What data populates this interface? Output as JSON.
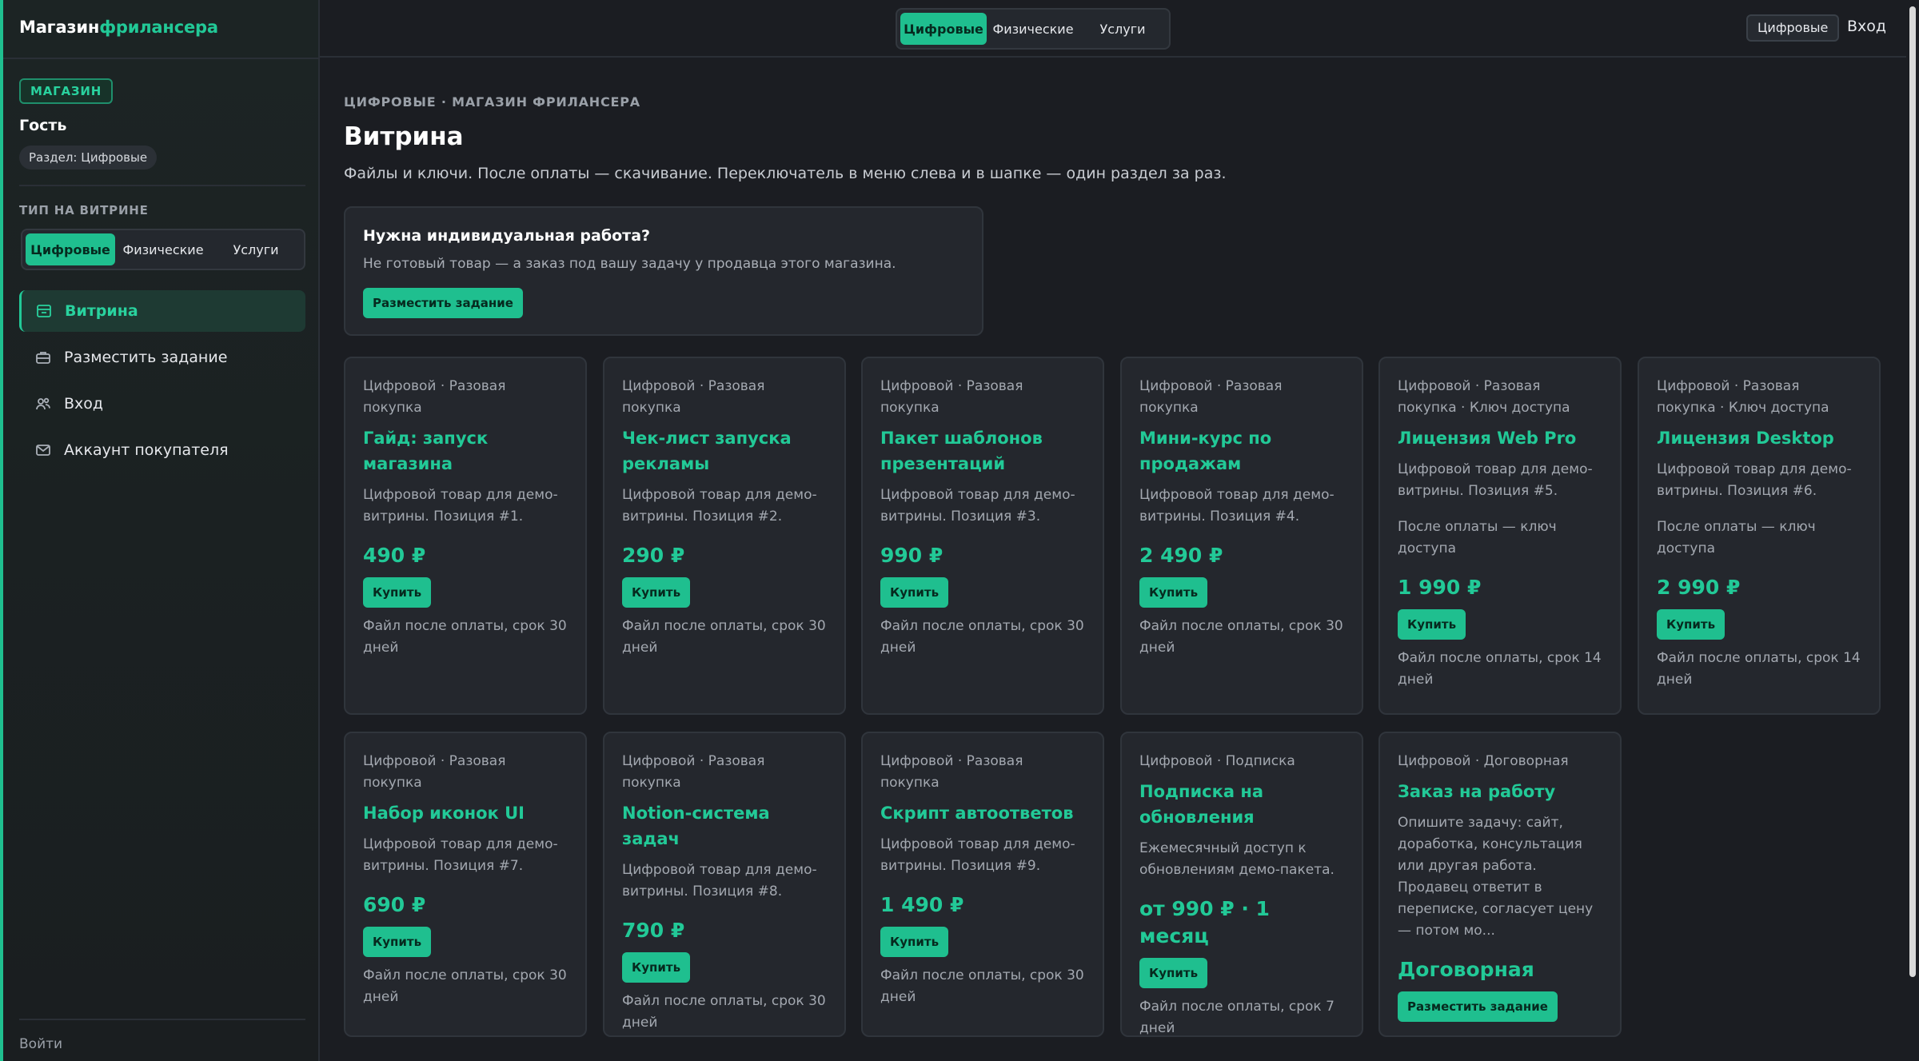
{
  "app": {
    "logo_part1": "Магазин",
    "logo_part2": "фрилансера"
  },
  "header": {
    "tabs": [
      "Цифровые",
      "Физические",
      "Услуги"
    ],
    "active_tab": 0,
    "chip": "Цифровые",
    "login": "Вход"
  },
  "sidebar": {
    "badge": "МАГАЗИН",
    "user": "Гость",
    "section_chip": "Раздел: Цифровые",
    "type_label": "ТИП НА ВИТРИНЕ",
    "type_options": [
      "Цифровые",
      "Физические",
      "Услуги"
    ],
    "nav": [
      {
        "label": "Витрина",
        "icon": "storefront-icon",
        "active": true
      },
      {
        "label": "Разместить задание",
        "icon": "briefcase-icon",
        "active": false
      },
      {
        "label": "Вход",
        "icon": "users-icon",
        "active": false
      },
      {
        "label": "Аккаунт покупателя",
        "icon": "mail-icon",
        "active": false
      }
    ],
    "logout": "Войти"
  },
  "main": {
    "breadcrumb": "ЦИФРОВЫЕ · МАГАЗИН ФРИЛАНСЕРА",
    "title": "Витрина",
    "description": "Файлы и ключи. После оплаты — скачивание. Переключатель в меню слева и в шапке — один раздел за раз.",
    "promo": {
      "title": "Нужна индивидуальная работа?",
      "text": "Не готовый товар — а заказ под вашу задачу у продавца этого магазина.",
      "button": "Разместить задание"
    },
    "products": [
      {
        "meta": "Цифровой · Разовая покупка",
        "name": "Гайд: запуск магазина",
        "desc": "Цифровой товар для демо-витрины. Позиция #1.",
        "extra": "",
        "price": "490 ₽",
        "button": "Купить",
        "note": "Файл после оплаты, срок 30 дней"
      },
      {
        "meta": "Цифровой · Разовая покупка",
        "name": "Чек-лист запуска рекламы",
        "desc": "Цифровой товар для демо-витрины. Позиция #2.",
        "extra": "",
        "price": "290 ₽",
        "button": "Купить",
        "note": "Файл после оплаты, срок 30 дней"
      },
      {
        "meta": "Цифровой · Разовая покупка",
        "name": "Пакет шаблонов презентаций",
        "desc": "Цифровой товар для демо-витрины. Позиция #3.",
        "extra": "",
        "price": "990 ₽",
        "button": "Купить",
        "note": "Файл после оплаты, срок 30 дней"
      },
      {
        "meta": "Цифровой · Разовая покупка",
        "name": "Мини-курс по продажам",
        "desc": "Цифровой товар для демо-витрины. Позиция #4.",
        "extra": "",
        "price": "2 490 ₽",
        "button": "Купить",
        "note": "Файл после оплаты, срок 30 дней"
      },
      {
        "meta": "Цифровой · Разовая покупка · Ключ доступа",
        "name": "Лицензия Web Pro",
        "desc": "Цифровой товар для демо-витрины. Позиция #5.",
        "extra": "После оплаты — ключ доступа",
        "price": "1 990 ₽",
        "button": "Купить",
        "note": "Файл после оплаты, срок 14 дней"
      },
      {
        "meta": "Цифровой · Разовая покупка · Ключ доступа",
        "name": "Лицензия Desktop",
        "desc": "Цифровой товар для демо-витрины. Позиция #6.",
        "extra": "После оплаты — ключ доступа",
        "price": "2 990 ₽",
        "button": "Купить",
        "note": "Файл после оплаты, срок 14 дней"
      },
      {
        "meta": "Цифровой · Разовая покупка",
        "name": "Набор иконок UI",
        "desc": "Цифровой товар для демо-витрины. Позиция #7.",
        "extra": "",
        "price": "690 ₽",
        "button": "Купить",
        "note": "Файл после оплаты, срок 30 дней"
      },
      {
        "meta": "Цифровой · Разовая покупка",
        "name": "Notion-система задач",
        "desc": "Цифровой товар для демо-витрины. Позиция #8.",
        "extra": "",
        "price": "790 ₽",
        "button": "Купить",
        "note": "Файл после оплаты, срок 30 дней"
      },
      {
        "meta": "Цифровой · Разовая покупка",
        "name": "Скрипт автоответов",
        "desc": "Цифровой товар для демо-витрины. Позиция #9.",
        "extra": "",
        "price": "1 490 ₽",
        "button": "Купить",
        "note": "Файл после оплаты, срок 30 дней"
      },
      {
        "meta": "Цифровой · Подписка",
        "name": "Подписка на обновления",
        "desc": "Ежемесячный доступ к обновлениям демо-пакета.",
        "extra": "",
        "price": "от 990 ₽ · 1 месяц",
        "button": "Купить",
        "note": "Файл после оплаты, срок 7 дней"
      },
      {
        "meta": "Цифровой · Договорная",
        "name": "Заказ на работу",
        "desc": "Опишите задачу: сайт, доработка, консультация или другая работа. Продавец ответит в переписке, согласует цену — потом мо...",
        "extra": "",
        "price": "Договорная",
        "button": "Разместить задание",
        "note": ""
      }
    ]
  },
  "colors": {
    "accent": "#1fbf8f",
    "background": "#1b1d22",
    "card": "#24272d"
  }
}
